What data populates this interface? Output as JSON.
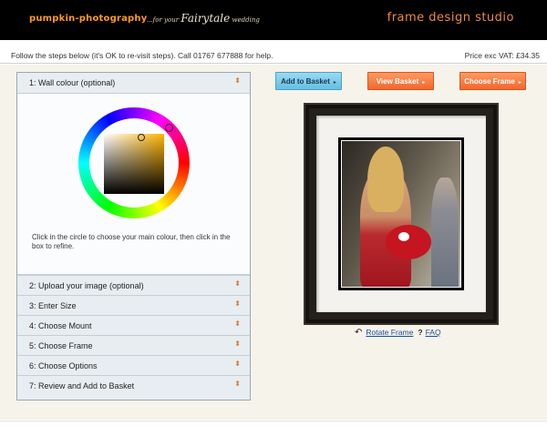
{
  "header": {
    "brand": "pumpkin-photography",
    "tagline_prefix": "...for your",
    "tagline_fancy": "Fairytale",
    "tagline_suffix": "wedding",
    "studio": "frame design studio"
  },
  "info": {
    "instructions": "Follow the steps below (it's OK to re-visit steps). Call 01767 677888 for help.",
    "price": "Price exc VAT: £34.35"
  },
  "steps": [
    {
      "label": "1: Wall colour (optional)",
      "icon": "updown-arrows-icon"
    },
    {
      "label": "2: Upload your image (optional)",
      "icon": "updown-arrows-icon"
    },
    {
      "label": "3: Enter Size",
      "icon": "updown-arrows-icon"
    },
    {
      "label": "4: Choose Mount",
      "icon": "updown-arrows-icon"
    },
    {
      "label": "5: Choose Frame",
      "icon": "updown-arrows-icon"
    },
    {
      "label": "6: Choose Options",
      "icon": "updown-arrows-icon"
    },
    {
      "label": "7: Review and Add to Basket",
      "icon": "updown-arrows-icon"
    }
  ],
  "colour_picker": {
    "help": "Click in the circle to choose your main colour, then click in the box to refine."
  },
  "buttons": {
    "add": "Add to Basket",
    "view": "View Basket",
    "choose": "Choose Frame"
  },
  "preview": {
    "rotate": "Rotate Frame",
    "faq_mark": "?",
    "faq": "FAQ"
  },
  "colors": {
    "brand_orange": "#ff9a1e",
    "button_orange": "#f2672c",
    "button_blue": "#64bfe2",
    "frame": "#231f1b"
  }
}
